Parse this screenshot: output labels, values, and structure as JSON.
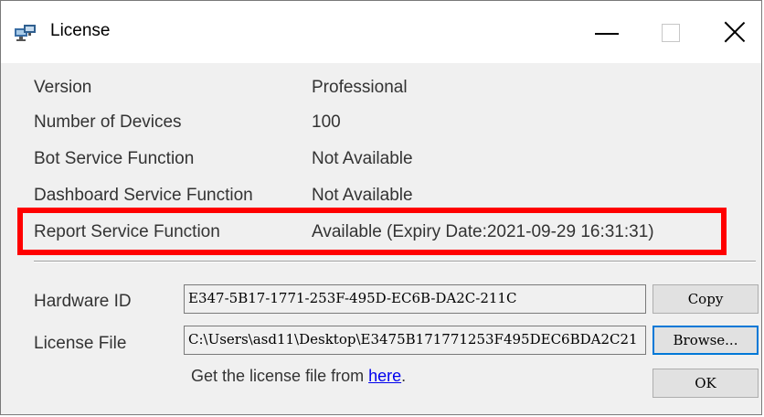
{
  "window": {
    "title": "License",
    "app_icon": "license-app-icon",
    "controls": {
      "minimize": "minimize-icon",
      "maximize": "maximize-icon",
      "close": "close-icon"
    }
  },
  "info": {
    "version_label": "Version",
    "version_value": "Professional",
    "devices_label": "Number of Devices",
    "devices_value": "100",
    "bot_label": "Bot Service Function",
    "bot_value": "Not Available",
    "dashboard_label": "Dashboard Service Function",
    "dashboard_value": "Not Available",
    "report_label": "Report Service Function",
    "report_value": "Available (Expiry Date:2021-09-29 16:31:31)"
  },
  "highlight_color": "#ff0000",
  "hardware": {
    "label": "Hardware ID",
    "value": "E347-5B17-1771-253F-495D-EC6B-DA2C-211C",
    "copy_label": "Copy"
  },
  "license_file": {
    "label": "License File",
    "value": "C:\\Users\\asd11\\Desktop\\E3475B171771253F495DEC6BDA2C21",
    "browse_label": "Browse..."
  },
  "hint": {
    "prefix": "Get the license file from ",
    "link": "here",
    "suffix": "."
  },
  "ok_label": "OK"
}
